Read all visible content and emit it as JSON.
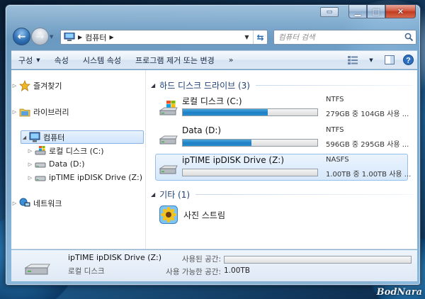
{
  "address": {
    "breadcrumb": "컴퓨터"
  },
  "search": {
    "placeholder": "컴퓨터 검색"
  },
  "toolbar": {
    "organize": "구성",
    "properties": "속성",
    "system_properties": "시스템 속성",
    "uninstall": "프로그램 제거 또는 변경",
    "more": "»"
  },
  "nav": {
    "favorites": "즐겨찾기",
    "libraries": "라이브러리",
    "computer": "컴퓨터",
    "drive_c": "로컬 디스크 (C:)",
    "drive_d": "Data (D:)",
    "drive_z": "ipTIME ipDISK Drive (Z:)",
    "network": "네트워크"
  },
  "groups": {
    "hdd": "하드 디스크 드라이브 (3)",
    "other": "기타 (1)"
  },
  "drives": [
    {
      "name": "로컬 디스크 (C:)",
      "fs": "NTFS",
      "space": "279GB 중 104GB 사용 ...",
      "used_fraction": 0.63
    },
    {
      "name": "Data (D:)",
      "fs": "NTFS",
      "space": "596GB 중 295GB 사용 ...",
      "used_fraction": 0.51
    },
    {
      "name": "ipTIME ipDISK Drive (Z:)",
      "fs": "NASFS",
      "space": "1.00TB 중 1.00TB 사용 ...",
      "used_fraction": 0.0
    }
  ],
  "other_items": {
    "photo_stream": "사진 스트림"
  },
  "details": {
    "name": "ipTIME ipDISK Drive (Z:)",
    "type": "로컬 디스크",
    "used_label": "사용된 공간:",
    "free_label": "사용 가능한 공간:",
    "free_value": "1.00TB",
    "used_fraction": 0.0
  },
  "watermark": "BodNara",
  "colors": {
    "bar_fill": "#1f7fc4",
    "selection": "#cfe4fb"
  }
}
